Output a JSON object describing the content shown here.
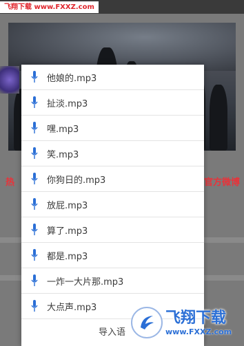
{
  "watermark_top": "飞翔下载 www.FXXZ.com",
  "background": {
    "hot_left": "热",
    "hot_right": "官方微博 :"
  },
  "popup": {
    "items": [
      {
        "label": "他娘的.mp3",
        "icon": "microphone-icon"
      },
      {
        "label": "扯淡.mp3",
        "icon": "microphone-icon"
      },
      {
        "label": "嘿.mp3",
        "icon": "microphone-icon"
      },
      {
        "label": "笑.mp3",
        "icon": "microphone-icon"
      },
      {
        "label": "你狗日的.mp3",
        "icon": "microphone-icon"
      },
      {
        "label": "放屁.mp3",
        "icon": "microphone-icon"
      },
      {
        "label": "算了.mp3",
        "icon": "microphone-icon"
      },
      {
        "label": "都是.mp3",
        "icon": "microphone-icon"
      },
      {
        "label": "一炸一大片那.mp3",
        "icon": "microphone-icon"
      },
      {
        "label": "大点声.mp3",
        "icon": "microphone-icon"
      }
    ],
    "import_label": "导入语"
  },
  "watermark_bottom": {
    "brand": "飞翔下载",
    "url": "www.FXXZ.com"
  },
  "colors": {
    "accent_blue": "#2b6fd6",
    "hot_red": "#e8333a"
  }
}
